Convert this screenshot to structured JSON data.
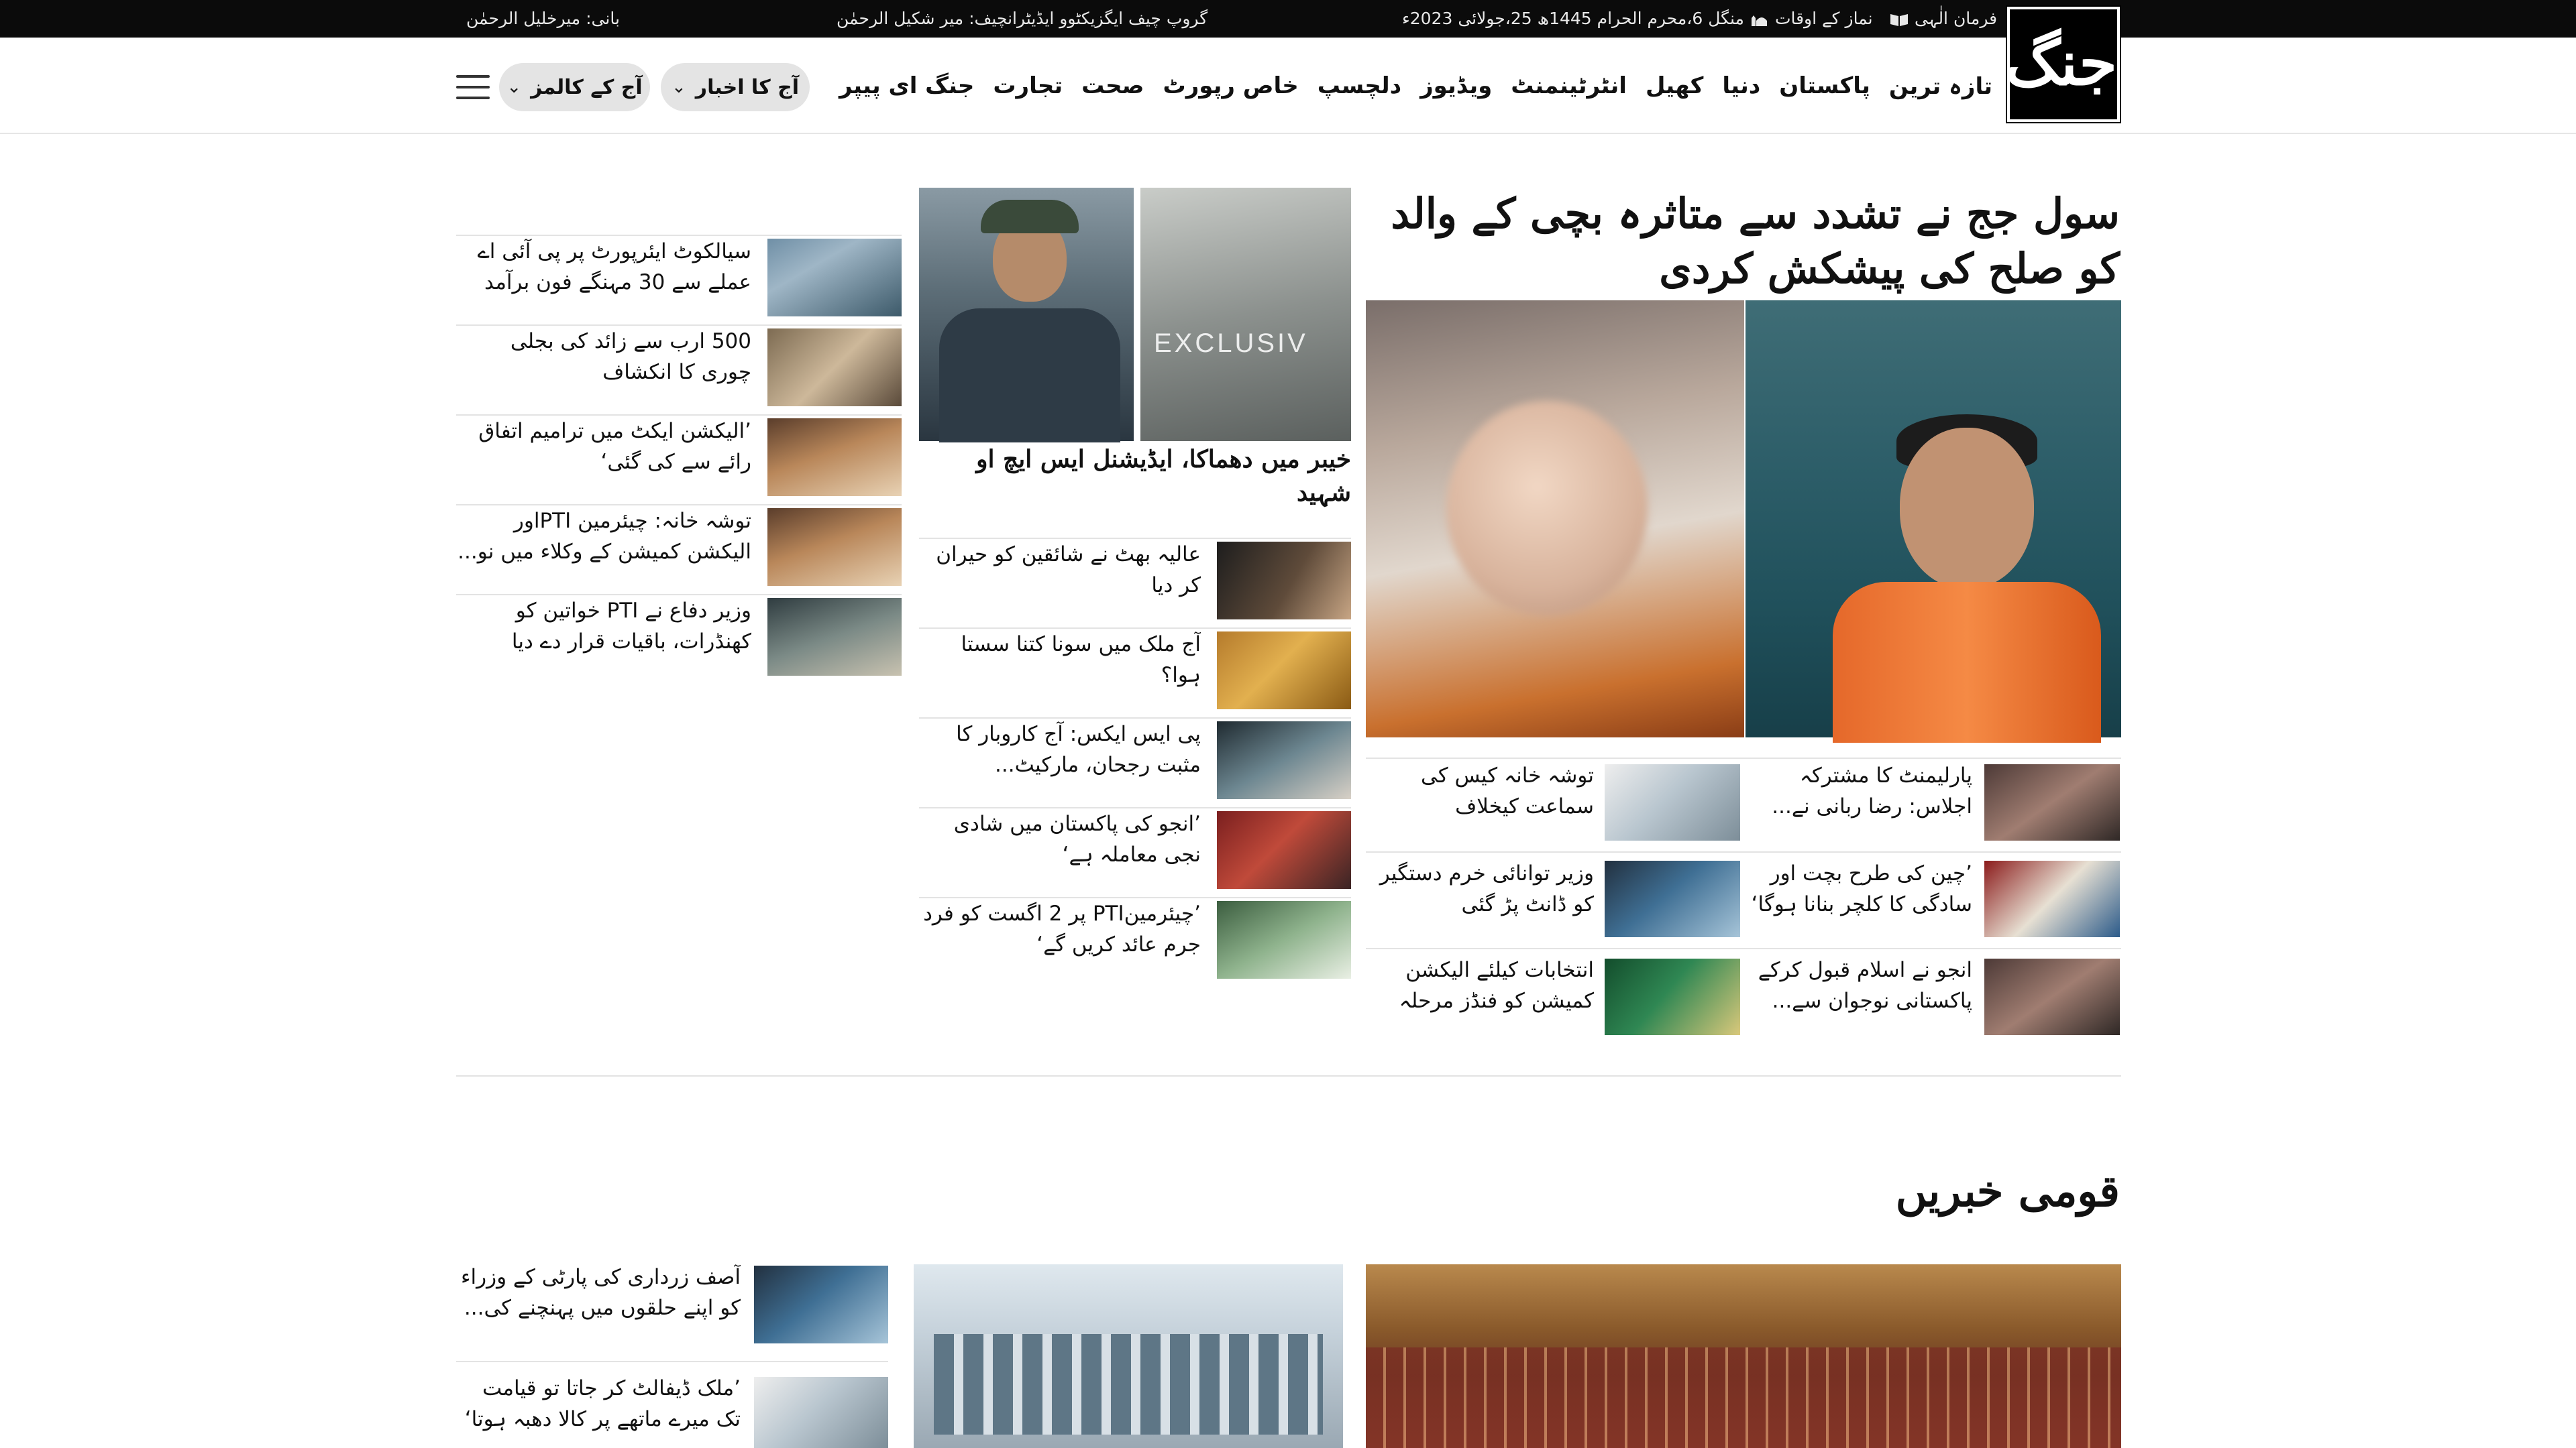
{
  "topbar": {
    "founder": "بانی: میرخلیل الرحمٰن",
    "group_chief": "گروپ چیف ایگزیکٹوو ایڈیٹرانچیف: میر شکیل الرحمٰن",
    "farman": "فرمان الٰہی",
    "prayer_times": "نماز کے اوقات",
    "date": "منگل 6،محرم الحرام 1445ھ 25،جولائی 2023ء"
  },
  "header": {
    "logo_text": "جنگ",
    "nav": [
      "تازہ ترین",
      "پاکستان",
      "دنیا",
      "کھیل",
      "انٹرٹینمنٹ",
      "ویڈیوز",
      "دلچسپ",
      "خاص رپورٹ",
      "صحت",
      "تجارت",
      "جنگ ای پیپر"
    ],
    "todays_news": "آج کا اخبار",
    "todays_columns": "آج کے کالمز"
  },
  "lead": {
    "headline": "سول جج نے تشدد سے متاثرہ بچی کے والد کو صلح کی پیشکش کردی",
    "stories": [
      {
        "text": "پارلیمنٹ کا مشترکہ اجلاس: رضا ربانی نے..."
      },
      {
        "text": "توشہ خانہ کیس کی سماعت کیخلاف چیئرمی..."
      },
      {
        "text": "’چین کی طرح بچت اور سادگی کا کلچر بنانا ہوگا‘"
      },
      {
        "text": "وزیر توانائی خرم دستگیر کو ڈانٹ پڑ گئی"
      },
      {
        "text": "انجو نے اسلام قبول کرکے پاکستانی نوجوان سے..."
      },
      {
        "text": "انتخابات کیلئے الیکشن کمیشن کو فنڈز مرحلہ و..."
      }
    ]
  },
  "middle": {
    "headline": "خیبر میں دھماکا، ایڈیشنل ایس ایچ او شہید",
    "photo_text": "EXCLUSIV",
    "stories": [
      {
        "text": "عالیہ بھٹ نے شائقین کو حیران کر دیا"
      },
      {
        "text": "آج ملک میں سونا کتنا سستا ہوا؟"
      },
      {
        "text": "پی ایس ایکس: آج کاروبار کا مثبت رجحان، مارکیٹ..."
      },
      {
        "text": "’انجو کی پاکستان میں شادی نجی معاملہ ہے‘"
      },
      {
        "text": "’چیئرمینPTI پر 2 اگست کو فرد جرم عائد کریں گے‘"
      }
    ]
  },
  "left": {
    "stories": [
      {
        "text": "سیالکوٹ ایئرپورٹ پر پی آئی اے عملے سے 30 مہنگے فون برآمد"
      },
      {
        "text": "500 ارب سے زائد کی بجلی چوری کا انکشاف"
      },
      {
        "text": "’الیکشن ایکٹ میں ترامیم اتفاق رائے سے کی گئی‘"
      },
      {
        "text": "توشہ خانہ: چیئرمین PTIاور الیکشن کمیشن کے وکلاء میں نو..."
      },
      {
        "text": "وزیر دفاع نے PTI خواتین کو کھنڈرات، باقیات قرار دے دیا"
      }
    ]
  },
  "national": {
    "title": "قومی خبریں",
    "stories": [
      {
        "text": "آصف زرداری کی پارٹی کے وزراء کو اپنے حلقوں میں پہنچنے کی..."
      },
      {
        "text": "’ملک ڈیفالٹ کر جاتا تو قیامت تک میرے ماتھے پر کالا دھبہ ہوتا‘"
      }
    ]
  }
}
